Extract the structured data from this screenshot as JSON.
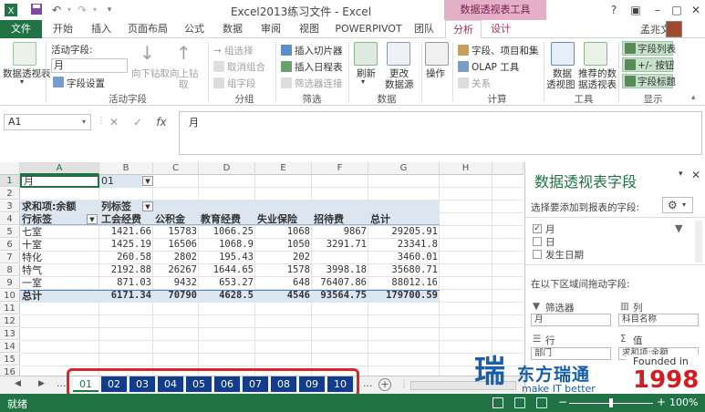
{
  "window": {
    "title": "Excel2013练习文件 - Excel",
    "context_tab": "数据透视表工具",
    "user": "孟兆文",
    "controls": [
      "?",
      "▣",
      "–",
      "□",
      "✕"
    ]
  },
  "tabs": [
    "文件",
    "开始",
    "插入",
    "页面布局",
    "公式",
    "数据",
    "审阅",
    "视图",
    "POWERPIVOT",
    "团队",
    "分析",
    "设计"
  ],
  "ribbon": {
    "pivot_table_btn": "数据透视表",
    "active_field_label": "活动字段:",
    "active_field_value": "月",
    "field_settings": "字段设置",
    "drill_down": "向下钻取",
    "drill_up": "向上钻",
    "drill_up2": "取",
    "group_active_field": "活动字段",
    "group_selection": "→ 组选择",
    "ungroup": "取消组合",
    "group_field": "组字段",
    "group_group": "分组",
    "insert_slicer": "插入切片器",
    "insert_timeline": "插入日程表",
    "filter_connections": "筛选器连接",
    "group_filter": "筛选",
    "refresh": "刷新",
    "change_source": "更改",
    "change_source2": "数据源",
    "group_data": "数据",
    "actions": "操作",
    "fields_items_sets": "字段、项目和集",
    "olap_tools": "OLAP 工具",
    "relationships": "关系",
    "group_calc": "计算",
    "pivot_chart": "数据",
    "pivot_chart2": "透视图",
    "recommended": "推荐的数",
    "recommended2": "据透视表",
    "group_tools": "工具",
    "field_list": "字段列表",
    "plus_minus": "+/- 按钮",
    "field_headers": "字段标题",
    "group_show": "显示"
  },
  "formula_bar": {
    "name_box": "A1",
    "formula": "月",
    "fx": "fx"
  },
  "columns": [
    "A",
    "B",
    "C",
    "D",
    "E",
    "F",
    "G",
    "H"
  ],
  "rows": [
    "1",
    "2",
    "3",
    "4",
    "5",
    "6",
    "7",
    "8",
    "9",
    "10",
    "11",
    "12",
    "13",
    "14",
    "15",
    "16"
  ],
  "sheet": {
    "a1": "月",
    "b1": "01",
    "sum_label": "求和项:余额",
    "col_label": "列标签",
    "row_label": "行标签",
    "headers": [
      "工会经费",
      "公积金",
      "教育经费",
      "失业保险",
      "招待费",
      "总计"
    ],
    "data_rows": [
      {
        "name": "七室",
        "values": [
          "1421.66",
          "15783",
          "1066.25",
          "1068",
          "9867",
          "29205.91"
        ]
      },
      {
        "name": "十室",
        "values": [
          "1425.19",
          "16506",
          "1068.9",
          "1050",
          "3291.71",
          "23341.8"
        ]
      },
      {
        "name": "特化",
        "values": [
          "260.58",
          "2802",
          "195.43",
          "202",
          "",
          "3460.01"
        ]
      },
      {
        "name": "特气",
        "values": [
          "2192.88",
          "26267",
          "1644.65",
          "1578",
          "3998.18",
          "35680.71"
        ]
      },
      {
        "name": "一室",
        "values": [
          "871.03",
          "9432",
          "653.27",
          "648",
          "76407.86",
          "88012.16"
        ]
      }
    ],
    "total": {
      "name": "总计",
      "values": [
        "6171.34",
        "70790",
        "4628.5",
        "4546",
        "93564.75",
        "179700.59"
      ]
    }
  },
  "sheet_tabs": [
    "01",
    "02",
    "03",
    "04",
    "05",
    "06",
    "07",
    "08",
    "09",
    "10"
  ],
  "sheet_nav": {
    "prev": "◀",
    "next": "▶",
    "more": "...",
    "add": "+"
  },
  "status": {
    "left": "就绪",
    "zoom": "100%"
  },
  "pane": {
    "title": "数据透视表字段",
    "choose_fields": "选择要添加到报表的字段:",
    "fields": [
      {
        "label": "月",
        "checked": true
      },
      {
        "label": "日",
        "checked": false
      },
      {
        "label": "发生日期",
        "checked": false
      }
    ],
    "drag_label": "在以下区域间拖动字段:",
    "filters": "筛选器",
    "columns": "列",
    "rows": "行",
    "values": "值",
    "filter_item": "月",
    "column_item": "科目名称",
    "row_item": "部门",
    "value_item": "求和项:余额"
  },
  "watermark": {
    "glyph": "瑞",
    "name_cn": "东方瑞通",
    "slogan": "make IT better",
    "founded": "Founded in",
    "year": "1998"
  }
}
